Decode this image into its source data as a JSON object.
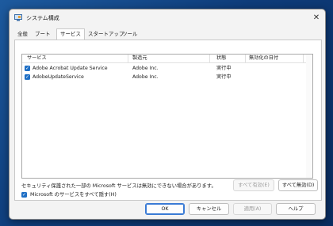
{
  "window": {
    "title": "システム構成",
    "close_glyph": "✕"
  },
  "tabs": [
    {
      "label": "全般"
    },
    {
      "label": "ブート"
    },
    {
      "label": "サービス"
    },
    {
      "label": "スタートアップ"
    },
    {
      "label": "ツール"
    }
  ],
  "services": {
    "columns": [
      "サービス",
      "製造元",
      "状態",
      "無効化の日付"
    ],
    "rows": [
      {
        "name": "Adobe Acrobat Update Service",
        "manufacturer": "Adobe Inc.",
        "status": "実行中",
        "disabled_date": "",
        "checked": true
      },
      {
        "name": "AdobeUpdateService",
        "manufacturer": "Adobe Inc.",
        "status": "実行中",
        "disabled_date": "",
        "checked": true
      }
    ],
    "note": "セキュリティ保護された一部の Microsoft サービスは無効にできない場合があります。",
    "enable_all_label": "すべて有効(E)",
    "disable_all_label": "すべて無効(D)",
    "hide_microsoft_label": "Microsoft のサービスをすべて隠す(H)",
    "hide_microsoft_checked": true
  },
  "footer": {
    "ok_label": "OK",
    "cancel_label": "キャンセル",
    "apply_label": "適用(A)",
    "help_label": "ヘルプ"
  },
  "colors": {
    "accent": "#1f6fc5",
    "desktop": "#0e3c7a"
  },
  "icons": {
    "app": "msconfig-icon",
    "checkbox": "check-icon"
  }
}
